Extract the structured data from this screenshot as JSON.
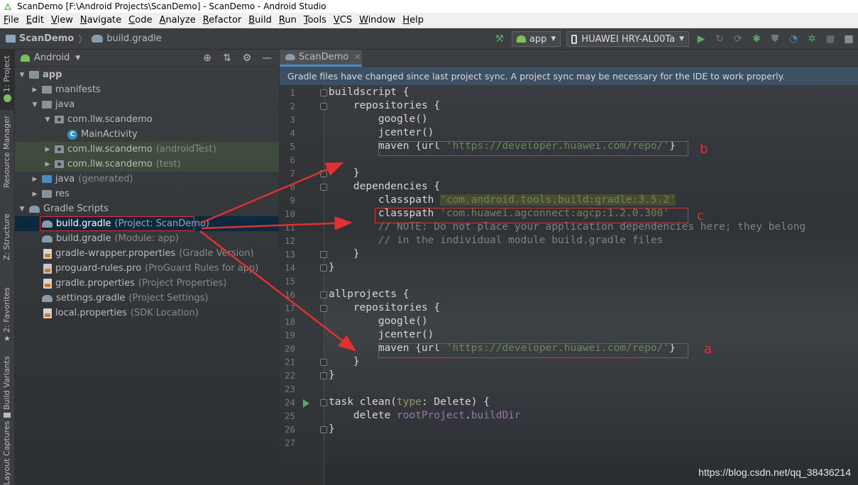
{
  "window": {
    "title": "ScanDemo [F:\\Android Projects\\ScanDemo] - ScanDemo - Android Studio"
  },
  "menu": [
    "File",
    "Edit",
    "View",
    "Navigate",
    "Code",
    "Analyze",
    "Refactor",
    "Build",
    "Run",
    "Tools",
    "VCS",
    "Window",
    "Help"
  ],
  "navbar": {
    "project": "ScanDemo",
    "file": "build.gradle",
    "run_config": "app",
    "device": "HUAWEI HRY-AL00Ta"
  },
  "stripe": {
    "project_tab": "1: Project",
    "resource_manager": "Resource Manager",
    "structure": "Z: Structure",
    "favorites": "2: Favorites",
    "build_variants": "Build Variants",
    "layout_captures": "Layout Captures"
  },
  "project_panel": {
    "view_mode": "Android",
    "tree": [
      {
        "label": "app",
        "secondary": ""
      },
      {
        "label": "manifests",
        "secondary": ""
      },
      {
        "label": "java",
        "secondary": ""
      },
      {
        "label": "com.llw.scandemo",
        "secondary": ""
      },
      {
        "label": "MainActivity",
        "secondary": ""
      },
      {
        "label": "com.llw.scandemo",
        "secondary": "(androidTest)"
      },
      {
        "label": "com.llw.scandemo",
        "secondary": "(test)"
      },
      {
        "label": "java",
        "secondary": "(generated)"
      },
      {
        "label": "res",
        "secondary": ""
      },
      {
        "label": "Gradle Scripts",
        "secondary": ""
      },
      {
        "label": "build.gradle",
        "secondary": "(Project: ScanDemo)"
      },
      {
        "label": "build.gradle",
        "secondary": "(Module: app)"
      },
      {
        "label": "gradle-wrapper.properties",
        "secondary": "(Gradle Version)"
      },
      {
        "label": "proguard-rules.pro",
        "secondary": "(ProGuard Rules for app)"
      },
      {
        "label": "gradle.properties",
        "secondary": "(Project Properties)"
      },
      {
        "label": "settings.gradle",
        "secondary": "(Project Settings)"
      },
      {
        "label": "local.properties",
        "secondary": "(SDK Location)"
      }
    ]
  },
  "editor": {
    "tab": "ScanDemo",
    "notice": "Gradle files have changed since last project sync. A project sync may be necessary for the IDE to work properly.",
    "line_numbers": [
      "1",
      "2",
      "3",
      "4",
      "5",
      "6",
      "7",
      "8",
      "9",
      "10",
      "11",
      "12",
      "13",
      "14",
      "15",
      "16",
      "17",
      "18",
      "19",
      "20",
      "21",
      "22",
      "23",
      "24",
      "25",
      "26",
      "27"
    ],
    "code": {
      "l1": "buildscript {",
      "l2": "    repositories {",
      "l3": "        google()",
      "l4": "        jcenter()",
      "l5a": "        maven {url ",
      "l5b": "'https://developer.huawei.com/repo/'",
      "l5c": "}",
      "l7": "    }",
      "l8": "    dependencies {",
      "l9a": "        classpath ",
      "l9b": "'com.android.tools.build:gradle:3.5.2'",
      "l10a": "        classpath ",
      "l10b": "'com.huawei.agconnect:agcp:1.2.0.300'",
      "l11": "        // NOTE: Do not place your application dependencies here; they belong",
      "l12": "        // in the individual module build.gradle files",
      "l13": "    }",
      "l14": "}",
      "l16": "allprojects {",
      "l17": "    repositories {",
      "l18": "        google()",
      "l19": "        jcenter()",
      "l20a": "        maven {url ",
      "l20b": "'https://developer.huawei.com/repo/'",
      "l20c": "}",
      "l21": "    }",
      "l22": "}",
      "l24a": "task clean(",
      "l24b": "type",
      "l24c": ": Delete) {",
      "l25a": "    delete ",
      "l25b": "rootProject",
      "l25c": ".",
      "l25d": "buildDir",
      "l26": "}"
    }
  },
  "annotations": {
    "a": "a",
    "b": "b",
    "c": "c"
  },
  "watermark": "https://blog.csdn.net/qq_38436214",
  "colors": {
    "accent": "#4a88c7",
    "annotation": "#e03030",
    "string": "#6a8759",
    "comment": "#808080"
  }
}
